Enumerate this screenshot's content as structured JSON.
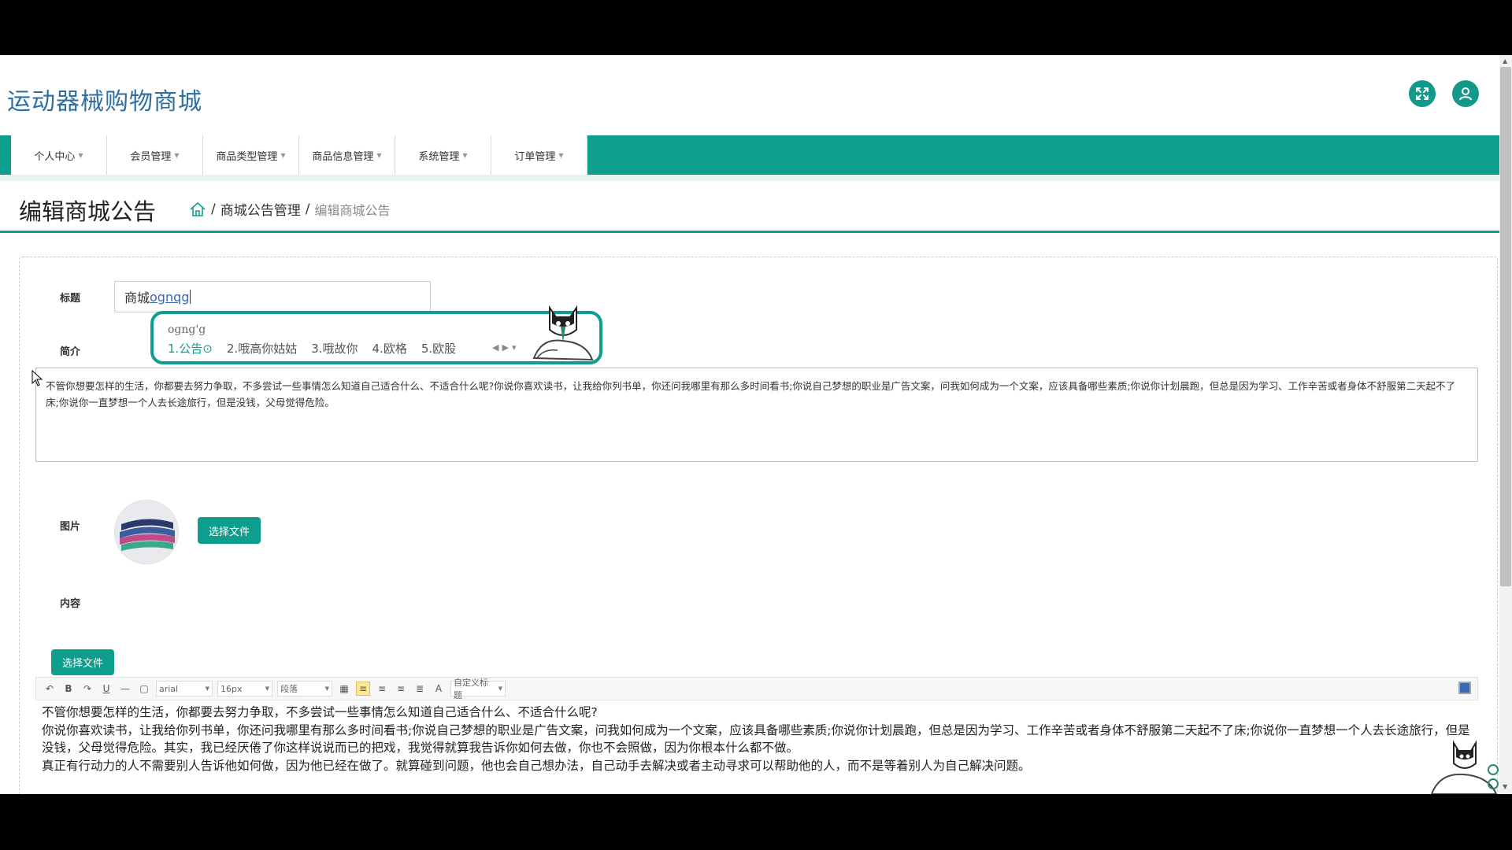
{
  "header": {
    "site_title": "运动器械购物商城",
    "icons": [
      "fullscreen-icon",
      "user-icon"
    ]
  },
  "nav": {
    "items": [
      {
        "label": "个人中心"
      },
      {
        "label": "会员管理"
      },
      {
        "label": "商品类型管理"
      },
      {
        "label": "商品信息管理"
      },
      {
        "label": "系统管理"
      },
      {
        "label": "订单管理"
      }
    ]
  },
  "page": {
    "heading": "编辑商城公告",
    "breadcrumb": {
      "separator": "/",
      "parent": "商城公告管理",
      "current": "编辑商城公告"
    }
  },
  "form": {
    "title_label": "标题",
    "title_value_prefix": "商城",
    "title_value_typing": "ognqg",
    "summary_label": "简介",
    "summary_text": "不管你想要怎样的生活，你都要去努力争取，不多尝试一些事情怎么知道自己适合什么、不适合什么呢?你说你喜欢读书，让我给你列书单，你还问我哪里有那么多时间看书;你说自己梦想的职业是广告文案，问我如何成为一个文案，应该具备哪些素质;你说你计划晨跑，但总是因为学习、工作辛苦或者身体不舒服第二天起不了床;你说你一直梦想一个人去长途旅行，但是没钱，父母觉得危险。",
    "image_label": "图片",
    "choose_file_label": "选择文件",
    "content_label": "内容",
    "content_choose_file_label": "选择文件"
  },
  "editor": {
    "font_family": "arial",
    "font_size": "16px",
    "paragraph": "段落",
    "custom_heading": "自定义标题",
    "paragraphs": [
      "不管你想要怎样的生活，你都要去努力争取，不多尝试一些事情怎么知道自己适合什么、不适合什么呢?",
      "你说你喜欢读书，让我给你列书单，你还问我哪里有那么多时间看书;你说自己梦想的职业是广告文案，问我如何成为一个文案，应该具备哪些素质;你说你计划晨跑，但总是因为学习、工作辛苦或者身体不舒服第二天起不了床;你说你一直梦想一个人去长途旅行，但是没钱，父母觉得危险。其实，我已经厌倦了你这样说说而已的把戏，我觉得就算我告诉你如何去做，你也不会照做，因为你根本什么都不做。",
      "真正有行动力的人不需要别人告诉他如何做，因为他已经在做了。就算碰到问题，他也会自己想办法，自己动手去解决或者主动寻求可以帮助他的人，而不是等着别人为自己解决问题。"
    ]
  },
  "ime": {
    "composition": "ogng'g",
    "candidates": [
      "1.公告⊙",
      "2.哦高你姑姑",
      "3.哦故你",
      "4.欧格",
      "5.欧股"
    ]
  },
  "colors": {
    "accent": "#0e9e8e",
    "title_blue": "#2f6ea0"
  }
}
